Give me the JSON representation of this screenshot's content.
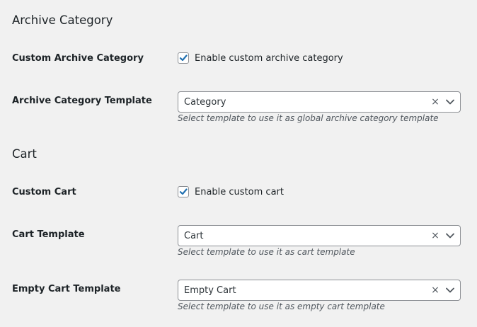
{
  "archive": {
    "title": "Archive Category",
    "custom_label": "Custom Archive Category",
    "checkbox_label": "Enable custom archive category",
    "checked": true,
    "template_label": "Archive Category Template",
    "template_value": "Category",
    "template_desc": "Select template to use it as global archive category template"
  },
  "cart": {
    "title": "Cart",
    "custom_label": "Custom Cart",
    "checkbox_label": "Enable custom cart",
    "checked": true,
    "template_label": "Cart Template",
    "template_value": "Cart",
    "template_desc": "Select template to use it as cart template",
    "empty_label": "Empty Cart Template",
    "empty_value": "Empty Cart",
    "empty_desc": "Select template to use it as empty cart template"
  },
  "icons": {
    "check": "checkmark-icon",
    "clear": "×",
    "chevron": "chevron-down-icon"
  },
  "colors": {
    "accent": "#2271b1",
    "background": "#f1f1f1"
  }
}
